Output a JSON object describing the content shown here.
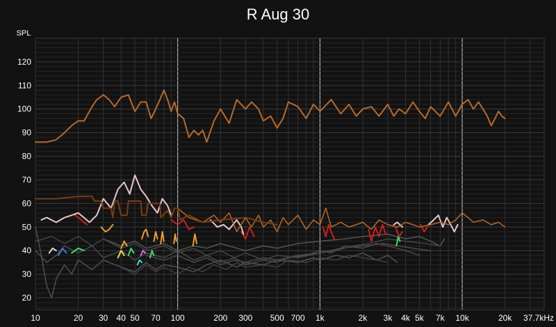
{
  "chart_data": {
    "type": "line",
    "title": "R Aug 30",
    "ylabel": "SPL",
    "x_scale": "log",
    "xlim": [
      10,
      37700
    ],
    "ylim": [
      15,
      130
    ],
    "grid": true,
    "x_ticks": [
      {
        "value": 10,
        "label": "10"
      },
      {
        "value": 20,
        "label": "20"
      },
      {
        "value": 30,
        "label": "30"
      },
      {
        "value": 40,
        "label": "40"
      },
      {
        "value": 50,
        "label": "50"
      },
      {
        "value": 70,
        "label": "70"
      },
      {
        "value": 100,
        "label": "100"
      },
      {
        "value": 200,
        "label": "200"
      },
      {
        "value": 300,
        "label": "300"
      },
      {
        "value": 500,
        "label": "500"
      },
      {
        "value": 700,
        "label": "700"
      },
      {
        "value": 1000,
        "label": "1k"
      },
      {
        "value": 2000,
        "label": "2k"
      },
      {
        "value": 3000,
        "label": "3k"
      },
      {
        "value": 4000,
        "label": "4k"
      },
      {
        "value": 5000,
        "label": "5k"
      },
      {
        "value": 7000,
        "label": "7k"
      },
      {
        "value": 10000,
        "label": "10k"
      },
      {
        "value": 20000,
        "label": "20k"
      },
      {
        "value": 37700,
        "label": "37.7kHz"
      }
    ],
    "y_ticks": [
      20,
      30,
      40,
      50,
      60,
      70,
      80,
      90,
      100,
      110,
      120
    ],
    "series": [
      {
        "color": "#b86a2c",
        "width": 2,
        "x": [
          10,
          12,
          14,
          16,
          18,
          20,
          22,
          25,
          27,
          30,
          33,
          36,
          40,
          45,
          50,
          55,
          60,
          65,
          70,
          75,
          80,
          85,
          90,
          95,
          100,
          110,
          120,
          130,
          140,
          150,
          160,
          180,
          200,
          230,
          260,
          300,
          330,
          370,
          400,
          450,
          500,
          550,
          600,
          700,
          800,
          900,
          1000,
          1200,
          1400,
          1600,
          1800,
          2000,
          2300,
          2600,
          3000,
          3300,
          3600,
          4000,
          4500,
          5000,
          5500,
          6000,
          7000,
          8000,
          9000,
          10000,
          11000,
          12000,
          13000,
          14000,
          15000,
          16000,
          17000,
          18000,
          19000,
          20000
        ],
        "y": [
          86,
          86,
          87,
          90,
          93,
          95,
          95,
          101,
          104,
          106,
          104,
          101,
          105,
          106,
          99,
          103,
          103,
          96,
          100,
          104,
          108,
          104,
          99,
          103,
          98,
          96,
          88,
          91,
          89,
          91,
          86,
          95,
          100,
          94,
          104,
          100,
          103,
          100,
          95,
          97,
          92,
          96,
          103,
          101,
          96,
          102,
          99,
          104,
          98,
          102,
          97,
          100,
          101,
          97,
          102,
          97,
          100,
          98,
          103,
          99,
          96,
          101,
          97,
          103,
          97,
          102,
          104,
          100,
          103,
          100,
          97,
          93,
          96,
          99,
          97,
          96
        ]
      },
      {
        "color": "#7a3d14",
        "width": 2,
        "x": [
          10,
          14,
          20,
          25,
          26,
          29,
          30,
          34,
          35,
          36,
          38,
          40,
          44,
          45,
          46,
          55,
          56,
          60,
          62,
          75,
          76,
          85,
          90,
          95,
          100,
          104,
          120,
          150,
          200,
          300,
          400,
          500
        ],
        "y": [
          62,
          62,
          63,
          63,
          61,
          61,
          58,
          58,
          54,
          61,
          61,
          55,
          55,
          61,
          61,
          61,
          55,
          55,
          60,
          60,
          54,
          57,
          54,
          58,
          58,
          53,
          55,
          52,
          53,
          54,
          52,
          51
        ]
      },
      {
        "color": "#b86a2c",
        "width": 1.5,
        "x": [
          100,
          120,
          150,
          180,
          200,
          230,
          260,
          300,
          330,
          370,
          400,
          450,
          500,
          550,
          600,
          700,
          800,
          900,
          1000,
          1100,
          1200,
          1400,
          1600,
          1800,
          2000,
          2300,
          2600,
          3000,
          3500,
          4000,
          4500,
          5000,
          6000,
          7000,
          8000,
          9000,
          10000,
          11000,
          12000,
          14000,
          16000,
          18000,
          20000
        ],
        "y": [
          58,
          54,
          52,
          55,
          52,
          56,
          48,
          54,
          50,
          55,
          50,
          53,
          48,
          54,
          51,
          55,
          49,
          53,
          51,
          58,
          50,
          52,
          50,
          51,
          52,
          49,
          53,
          51,
          50,
          52,
          51,
          50,
          51,
          52,
          51,
          53,
          56,
          54,
          52,
          53,
          51,
          52,
          50
        ]
      },
      {
        "color": "#e8c8cc",
        "width": 2,
        "x": [
          11,
          12,
          14,
          16,
          18,
          20,
          24,
          27,
          30,
          34,
          38,
          42,
          46,
          50,
          55,
          60,
          66,
          72,
          78,
          85,
          90
        ],
        "y": [
          53,
          54,
          52,
          54,
          55,
          56,
          52,
          55,
          62,
          58,
          66,
          69,
          64,
          72,
          66,
          63,
          59,
          56,
          62,
          59,
          55
        ]
      },
      {
        "color": "#e8c8cc",
        "width": 2,
        "x": [
          170,
          190,
          210,
          230,
          260,
          280,
          290
        ],
        "y": [
          53,
          50,
          51,
          49,
          53,
          50,
          47
        ]
      },
      {
        "color": "#e8c8cc",
        "width": 2,
        "x": [
          5800,
          6300,
          6800,
          7300,
          7800,
          8300,
          8800,
          9300
        ],
        "y": [
          51,
          53,
          55,
          50,
          54,
          51,
          48,
          51
        ]
      },
      {
        "color": "#e8c8cc",
        "width": 2,
        "x": [
          3300,
          3500,
          3800
        ],
        "y": [
          51,
          52,
          50
        ]
      },
      {
        "color": "#cc1f1f",
        "width": 2,
        "x": [
          19,
          21,
          23
        ],
        "y": [
          55,
          53,
          51
        ]
      },
      {
        "color": "#cc1f1f",
        "width": 2,
        "x": [
          90,
          100,
          110,
          120,
          130
        ],
        "y": [
          53,
          51,
          53,
          49,
          50
        ]
      },
      {
        "color": "#cc1f1f",
        "width": 2,
        "x": [
          280,
          300,
          320,
          345
        ],
        "y": [
          48,
          45,
          50,
          46
        ]
      },
      {
        "color": "#cc1f1f",
        "width": 2,
        "x": [
          1050,
          1100,
          1150,
          1200,
          1260
        ],
        "y": [
          50,
          46,
          51,
          48,
          45
        ]
      },
      {
        "color": "#cc1f1f",
        "width": 2,
        "x": [
          2200,
          2300,
          2450,
          2600,
          2750,
          2900
        ],
        "y": [
          49,
          44,
          50,
          46,
          51,
          47
        ]
      },
      {
        "color": "#cc1f1f",
        "width": 2,
        "x": [
          3400,
          3600,
          3800
        ],
        "y": [
          50,
          46,
          48
        ]
      },
      {
        "color": "#cc1f1f",
        "width": 2,
        "x": [
          5100,
          5400,
          5700
        ],
        "y": [
          51,
          48,
          50
        ]
      },
      {
        "color": "#e8a12a",
        "width": 2,
        "x": [
          29,
          31,
          33,
          35
        ],
        "y": [
          50,
          48,
          49,
          51
        ]
      },
      {
        "color": "#e8a12a",
        "width": 2,
        "x": [
          56,
          58,
          60,
          62
        ],
        "y": [
          45,
          48,
          49,
          46
        ]
      },
      {
        "color": "#e8a12a",
        "width": 2,
        "x": [
          68,
          70,
          72
        ],
        "y": [
          44,
          48,
          45
        ]
      },
      {
        "color": "#e8a12a",
        "width": 2,
        "x": [
          76,
          78,
          80
        ],
        "y": [
          43,
          48,
          44
        ]
      },
      {
        "color": "#e8a12a",
        "width": 2,
        "x": [
          94,
          96,
          98
        ],
        "y": [
          43,
          47,
          44
        ]
      },
      {
        "color": "#e8a12a",
        "width": 2,
        "x": [
          128,
          132,
          136
        ],
        "y": [
          42,
          47,
          43
        ]
      },
      {
        "color": "#e8a12a",
        "width": 2,
        "x": [
          40,
          42,
          44
        ],
        "y": [
          41,
          44,
          42
        ]
      },
      {
        "color": "#f0e050",
        "width": 2,
        "x": [
          38,
          40,
          42
        ],
        "y": [
          37,
          40,
          38
        ]
      },
      {
        "color": "#3a7bd5",
        "width": 2,
        "x": [
          14.5,
          15.5,
          16.5
        ],
        "y": [
          38,
          41,
          39
        ]
      },
      {
        "color": "#3ddc6a",
        "width": 2,
        "x": [
          18,
          20,
          22
        ],
        "y": [
          39,
          41,
          40
        ]
      },
      {
        "color": "#3ddc6a",
        "width": 2,
        "x": [
          45,
          47,
          49
        ],
        "y": [
          38,
          41,
          39
        ]
      },
      {
        "color": "#3ddc6a",
        "width": 2,
        "x": [
          64,
          66,
          68
        ],
        "y": [
          37,
          40,
          38
        ]
      },
      {
        "color": "#3ddc6a",
        "width": 2,
        "x": [
          3450,
          3550,
          3650
        ],
        "y": [
          42,
          46,
          44
        ]
      },
      {
        "color": "#d070e0",
        "width": 2,
        "x": [
          55,
          57,
          59
        ],
        "y": [
          38,
          40,
          39
        ]
      },
      {
        "color": "#40d8e0",
        "width": 2,
        "x": [
          52,
          54,
          56
        ],
        "y": [
          34,
          36,
          35
        ]
      },
      {
        "color": "#e8d8d8",
        "width": 2,
        "x": [
          12.5,
          13.2,
          14
        ],
        "y": [
          39,
          41,
          40
        ]
      },
      {
        "color": "#505050",
        "width": 1.5,
        "x": [
          10,
          11,
          12,
          13,
          14,
          16,
          18,
          20,
          25,
          30,
          40,
          50,
          60,
          70,
          80,
          100,
          130,
          160,
          200,
          260,
          300,
          400,
          500,
          700,
          900,
          1000,
          1300,
          1600,
          2000,
          2500,
          3000,
          3500
        ],
        "y": [
          50,
          38,
          25,
          20,
          28,
          34,
          30,
          36,
          32,
          36,
          33,
          31,
          35,
          32,
          34,
          33,
          31,
          34,
          36,
          33,
          35,
          34,
          36,
          35,
          37,
          36,
          38,
          37,
          39,
          36,
          38,
          35
        ]
      },
      {
        "color": "#4a4a4a",
        "width": 1.5,
        "x": [
          10,
          12,
          14,
          16,
          20,
          25,
          30,
          40,
          50,
          60,
          80,
          100,
          130,
          160,
          200,
          250,
          300,
          400,
          500,
          600,
          800,
          1000,
          1200,
          1500,
          2000,
          2500,
          3000,
          4000,
          5000
        ],
        "y": [
          40,
          35,
          38,
          42,
          39,
          42,
          37,
          40,
          36,
          39,
          37,
          40,
          36,
          38,
          35,
          37,
          34,
          36,
          35,
          37,
          38,
          40,
          39,
          42,
          41,
          43,
          42,
          40,
          38
        ]
      },
      {
        "color": "#444444",
        "width": 1.5,
        "x": [
          10,
          13,
          16,
          20,
          25,
          30,
          40,
          50,
          60,
          80,
          100,
          130,
          160,
          200,
          250,
          300,
          400,
          500,
          700,
          1000,
          1300,
          1700,
          2200,
          3000,
          4000,
          5500,
          7000
        ],
        "y": [
          44,
          46,
          43,
          46,
          42,
          45,
          41,
          43,
          40,
          42,
          39,
          41,
          38,
          40,
          37,
          39,
          36,
          38,
          37,
          39,
          40,
          42,
          43,
          45,
          44,
          43,
          42
        ]
      },
      {
        "color": "#555555",
        "width": 1.5,
        "x": [
          30,
          40,
          50,
          60,
          80,
          100,
          130,
          160,
          200,
          300,
          400,
          500,
          700,
          1000,
          1500,
          2000,
          3000,
          4000,
          5000,
          6000,
          7000,
          7500
        ],
        "y": [
          45,
          42,
          44,
          41,
          43,
          40,
          42,
          41,
          43,
          40,
          42,
          41,
          43,
          44,
          45,
          46,
          47,
          45,
          46,
          44,
          42,
          45
        ]
      },
      {
        "color": "#3f3f3f",
        "width": 1.5,
        "x": [
          40,
          50,
          60,
          70,
          80,
          100,
          120,
          150,
          180,
          220,
          260,
          300,
          400,
          500,
          600,
          800,
          1000,
          1300,
          1600,
          2000,
          2500,
          3000
        ],
        "y": [
          33,
          30,
          34,
          31,
          33,
          30,
          33,
          31,
          34,
          32,
          35,
          33,
          34,
          33,
          36,
          35,
          37,
          36,
          38,
          37,
          36,
          35
        ]
      },
      {
        "color": "#4c4c4c",
        "width": 1.5,
        "x": [
          60,
          80,
          100,
          130,
          160,
          200,
          250,
          300,
          400,
          500,
          700,
          1000,
          1400,
          2000,
          2800,
          3500,
          4500,
          6000
        ],
        "y": [
          38,
          36,
          38,
          35,
          37,
          34,
          36,
          35,
          37,
          36,
          38,
          39,
          41,
          42,
          43,
          42,
          41,
          40
        ]
      }
    ]
  }
}
